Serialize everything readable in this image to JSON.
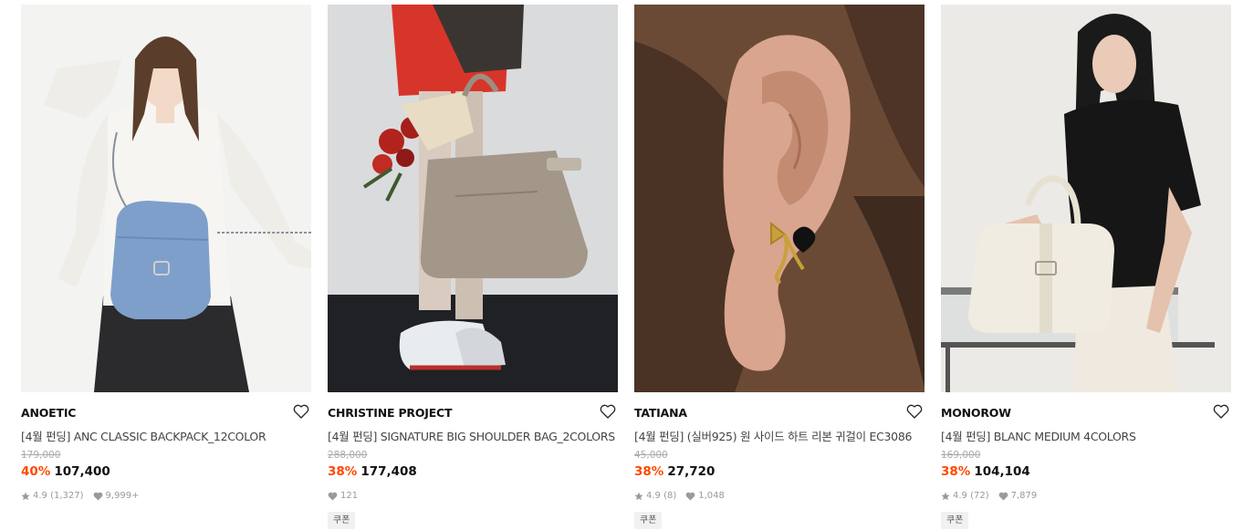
{
  "products": [
    {
      "brand": "ANOETIC",
      "title": "[4월 펀딩] ANC CLASSIC BACKPACK_12COLOR",
      "original_price": "179,000",
      "discount": "40%",
      "price": "107,400",
      "rating": "4.9",
      "review_count": "(1,327)",
      "likes": "9,999+",
      "coupon": ""
    },
    {
      "brand": "CHRISTINE PROJECT",
      "title": "[4월 펀딩] SIGNATURE BIG SHOULDER BAG_2COLORS",
      "original_price": "288,000",
      "discount": "38%",
      "price": "177,408",
      "rating": "",
      "review_count": "",
      "likes": "121",
      "coupon": "쿠폰"
    },
    {
      "brand": "TATIANA",
      "title": "[4월 펀딩] (실버925) 원 사이드 하트 리본 귀걸이 EC3086",
      "original_price": "45,000",
      "discount": "38%",
      "price": "27,720",
      "rating": "4.9",
      "review_count": "(8)",
      "likes": "1,048",
      "coupon": "쿠폰"
    },
    {
      "brand": "MONOROW",
      "title": "[4월 펀딩] BLANC MEDIUM 4COLORS",
      "original_price": "169,000",
      "discount": "38%",
      "price": "104,104",
      "rating": "4.9",
      "review_count": "(72)",
      "likes": "7,879",
      "coupon": "쿠폰"
    }
  ],
  "icons": {
    "wishlist": "heart-outline-icon",
    "rating": "star-icon",
    "likes": "heart-filled-icon"
  },
  "colors": {
    "discount": "#ff4800",
    "text": "#111111",
    "muted": "#999999",
    "strike": "#aaaaaa",
    "coupon_bg": "#f1f1f1"
  }
}
